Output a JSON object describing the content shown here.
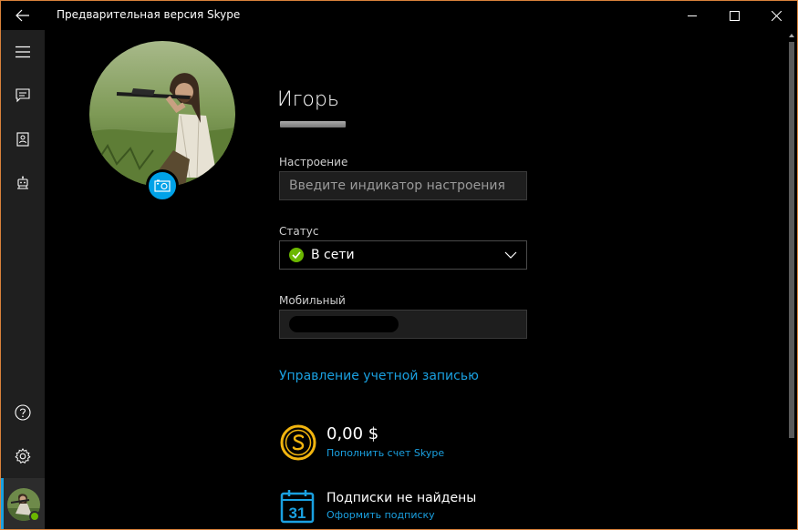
{
  "window": {
    "title": "Предварительная версия Skype",
    "frame_color": "#d9823b"
  },
  "titlebar": {
    "back_icon": "arrow-left-icon",
    "minimize_icon": "minimize-icon",
    "maximize_icon": "maximize-icon",
    "close_icon": "close-icon"
  },
  "rail": {
    "items": [
      {
        "icon": "hamburger-menu-icon"
      },
      {
        "icon": "chat-icon"
      },
      {
        "icon": "contacts-icon"
      },
      {
        "icon": "bot-icon"
      },
      {
        "icon": "help-icon"
      },
      {
        "icon": "settings-gear-icon"
      }
    ],
    "presence_color": "#6bb700"
  },
  "profile": {
    "name": "Игорь",
    "camera_icon": "camera-icon"
  },
  "mood": {
    "label": "Настроение",
    "placeholder": "Введите индикатор настроения",
    "value": ""
  },
  "status": {
    "label": "Статус",
    "value": "В сети",
    "color": "#6bb700"
  },
  "mobile": {
    "label": "Мобильный"
  },
  "account": {
    "manage_link": "Управление учетной записью"
  },
  "credit": {
    "amount": "0,00 $",
    "link": "Пополнить счет Skype",
    "icon": "skype-credit-coin-icon"
  },
  "subscription": {
    "text": "Подписки не найдены",
    "link": "Оформить подписку",
    "icon": "calendar-icon",
    "calendar_day": "31"
  },
  "accent_color": "#1aa0e0"
}
